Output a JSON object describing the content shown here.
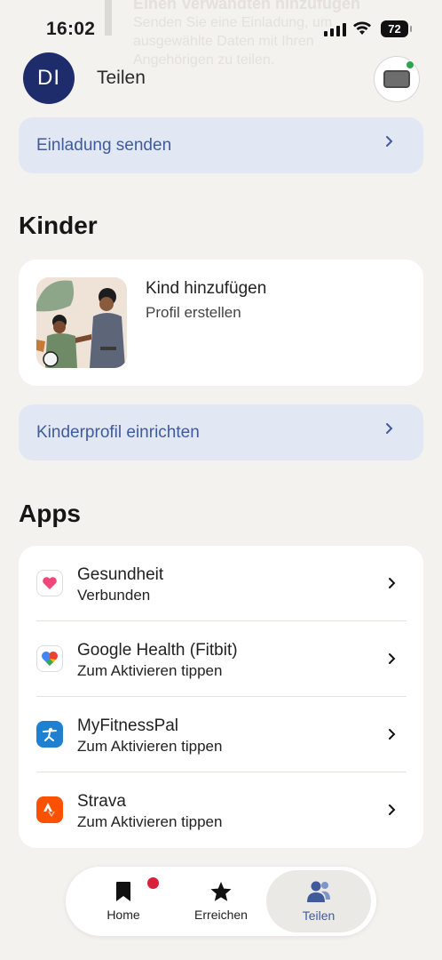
{
  "background_text": {
    "title": "Einen Verwandten hinzufügen",
    "lines": [
      "Senden Sie eine Einladung, um",
      "ausgewählte Daten mit Ihren",
      "Angehörigen zu teilen."
    ]
  },
  "status_bar": {
    "time": "16:02",
    "battery": "72"
  },
  "header": {
    "avatar_initials": "DI",
    "title": "Teilen"
  },
  "invite": {
    "label": "Einladung senden"
  },
  "kids": {
    "section_title": "Kinder",
    "card_title": "Kind hinzufügen",
    "card_subtitle": "Profil erstellen",
    "setup_label": "Kinderprofil einrichten"
  },
  "apps": {
    "section_title": "Apps",
    "items": [
      {
        "name": "Gesundheit",
        "status": "Verbunden",
        "icon": "apple-health-icon"
      },
      {
        "name": "Google Health (Fitbit)",
        "status": "Zum Aktivieren tippen",
        "icon": "google-health-icon"
      },
      {
        "name": "MyFitnessPal",
        "status": "Zum Aktivieren tippen",
        "icon": "myfitnesspal-icon"
      },
      {
        "name": "Strava",
        "status": "Zum Aktivieren tippen",
        "icon": "strava-icon"
      }
    ]
  },
  "nav": {
    "items": [
      {
        "label": "Home",
        "icon": "bookmark-icon"
      },
      {
        "label": "Erreichen",
        "icon": "star-icon"
      },
      {
        "label": "Teilen",
        "icon": "people-icon"
      }
    ],
    "active": "Teilen"
  },
  "colors": {
    "accent": "#3f5b9c",
    "avatar": "#1f2c6b",
    "badge": "#d8213a",
    "row_bg": "#e1e8f4",
    "page_bg": "#f4f2ef"
  }
}
